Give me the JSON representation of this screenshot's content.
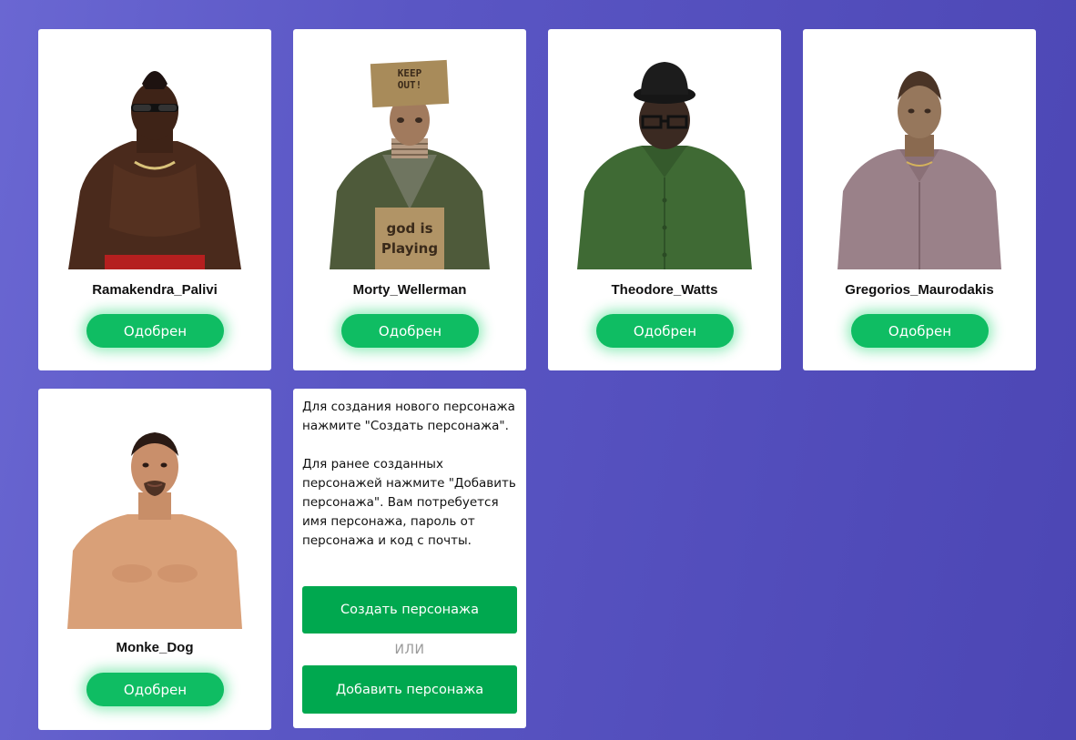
{
  "colors": {
    "approved_button": "#0fbd63",
    "action_button": "#00a84f",
    "background_start": "#6a67d2",
    "background_end": "#4c46b4"
  },
  "characters": [
    {
      "name": "Ramakendra_Palivi",
      "status": "Одобрен",
      "portrait": "shirtless-man-sunglasses-mohawk"
    },
    {
      "name": "Morty_Wellerman",
      "status": "Одобрен",
      "portrait": "man-cardboard-box-hat-keep-out"
    },
    {
      "name": "Theodore_Watts",
      "status": "Одобрен",
      "portrait": "man-black-hat-glasses-green-shirt"
    },
    {
      "name": "Gregorios_Maurodakis",
      "status": "Одобрен",
      "portrait": "man-mauve-shirt-chain"
    },
    {
      "name": "Monke_Dog",
      "status": "Одобрен",
      "portrait": "shirtless-man-goatee"
    }
  ],
  "portrait_text": {
    "box_hat": "KEEP OUT!",
    "sign_line1": "god is",
    "sign_line2": "Playing"
  },
  "info": {
    "paragraph1": "Для создания нового персонажа нажмите \"Создать персонажа\".",
    "paragraph2": "Для ранее созданных персонажей нажмите \"Добавить персонажа\". Вам потребуется имя персонажа, пароль от персонажа и код с почты.",
    "create_button": "Создать персонажа",
    "or_label": "ИЛИ",
    "add_button": "Добавить персонажа"
  }
}
